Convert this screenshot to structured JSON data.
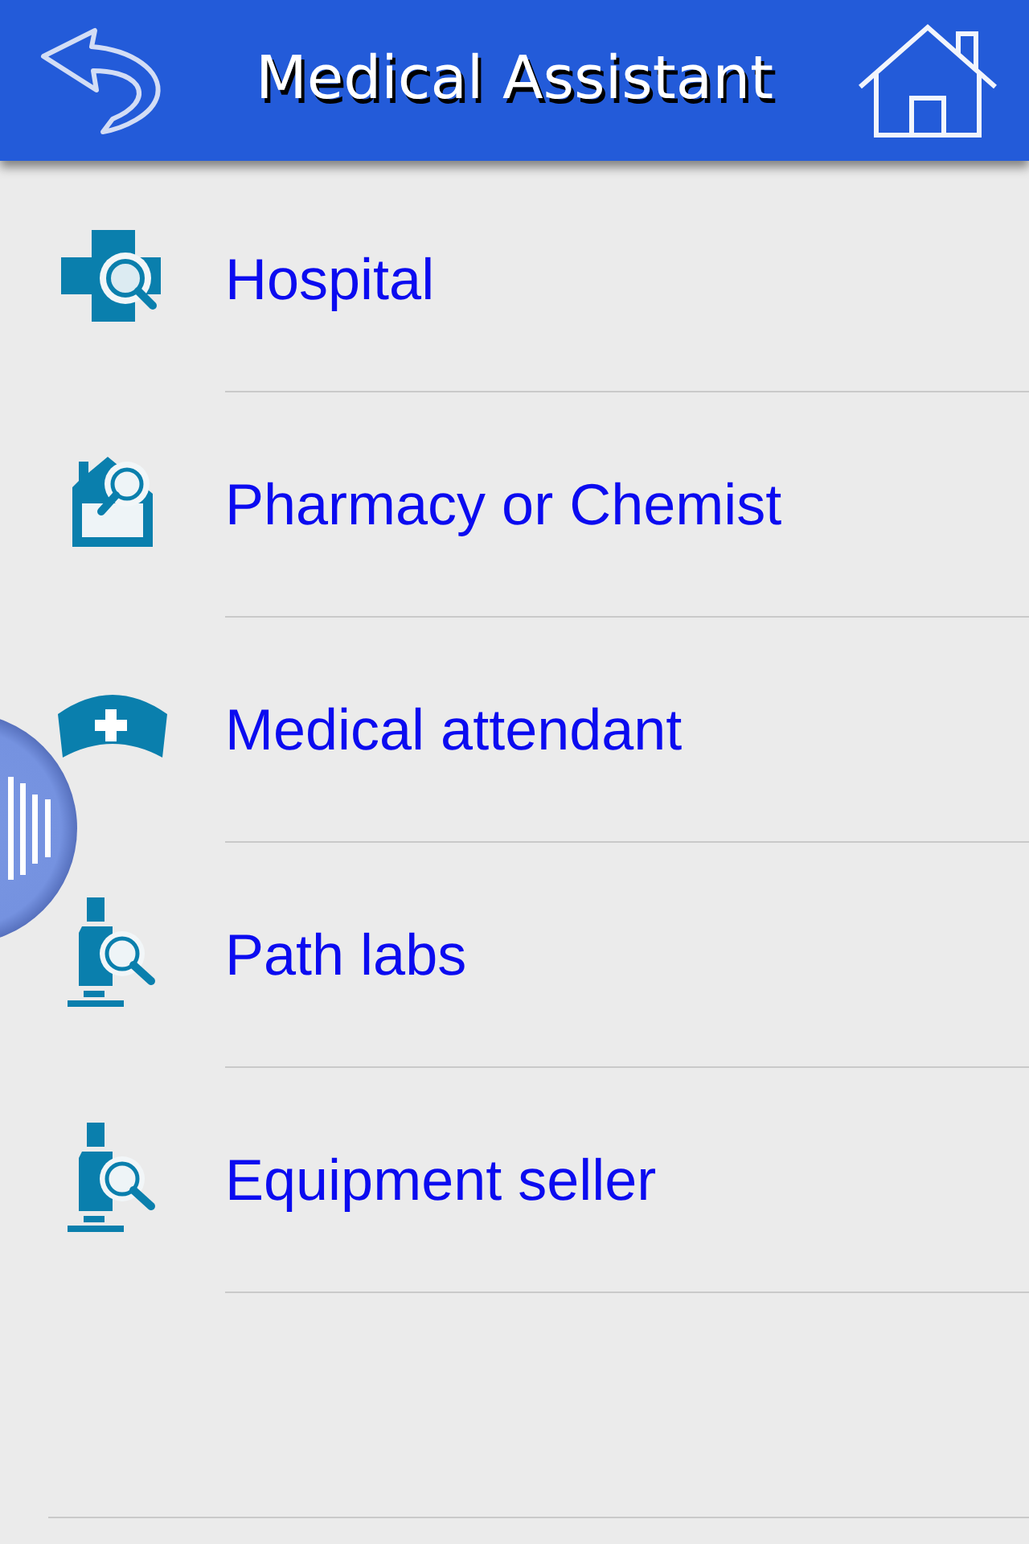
{
  "header": {
    "title": "Medical Assistant"
  },
  "items": [
    {
      "label": "Hospital",
      "kind": "cross"
    },
    {
      "label": "Pharmacy or Chemist",
      "kind": "house"
    },
    {
      "label": "Medical attendant",
      "kind": "cap"
    },
    {
      "label": "Path labs",
      "kind": "microscope"
    },
    {
      "label": "Equipment seller",
      "kind": "microscope"
    }
  ]
}
